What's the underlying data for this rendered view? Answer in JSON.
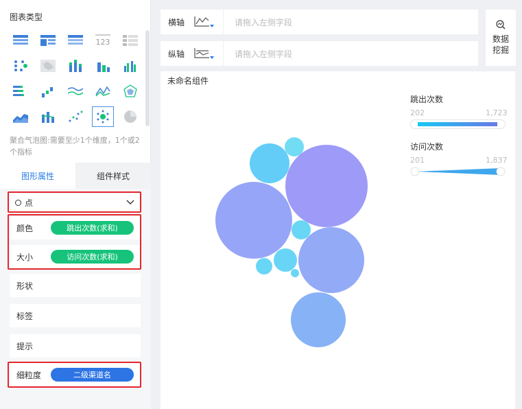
{
  "left_panel": {
    "section_title": "图表类型",
    "chart_types": [
      {
        "icon": "table-icon"
      },
      {
        "icon": "cross-table-icon"
      },
      {
        "icon": "detail-table-icon"
      },
      {
        "icon": "kpi-number-icon",
        "text": "123"
      },
      {
        "icon": "list-icon"
      },
      {
        "icon": "dot-matrix-icon"
      },
      {
        "icon": "map-icon"
      },
      {
        "icon": "stacked-column-icon"
      },
      {
        "icon": "column-icon"
      },
      {
        "icon": "grouped-column-icon"
      },
      {
        "icon": "bar-icon"
      },
      {
        "icon": "waterfall-icon"
      },
      {
        "icon": "line-icon"
      },
      {
        "icon": "radar-line-icon"
      },
      {
        "icon": "radar-icon"
      },
      {
        "icon": "area-icon"
      },
      {
        "icon": "combo-icon"
      },
      {
        "icon": "scatter-icon"
      },
      {
        "icon": "bubble-icon"
      },
      {
        "icon": "pie-icon"
      }
    ],
    "hint": "聚合气泡图:需要至少1个维度，1个或2个指标",
    "tabs": [
      "图形属性",
      "组件样式"
    ],
    "mark_type": "点",
    "properties": {
      "color_label": "颜色",
      "color_field": "跳出次数(求和)",
      "size_label": "大小",
      "size_field": "访问次数(求和)",
      "shape_label": "形状",
      "label_label": "标签",
      "tooltip_label": "提示",
      "granularity_label": "细粒度",
      "granularity_field": "二级渠道名"
    }
  },
  "shelves": {
    "x_label": "横轴",
    "x_placeholder": "请拖入左侧字段",
    "y_label": "纵轴",
    "y_placeholder": "请拖入左侧字段"
  },
  "data_mining": {
    "line1": "数据",
    "line2": "挖掘"
  },
  "chart": {
    "title": "未命名组件",
    "legend": {
      "color_title": "跳出次数",
      "color_min": "202",
      "color_max": "1,723",
      "size_title": "访问次数",
      "size_min": "201",
      "size_max": "1,837"
    }
  },
  "colors": {
    "accent": "#2b7de9",
    "green_pill": "#17c37b",
    "blue_pill": "#2d74e4",
    "highlight": "#e5262d"
  }
}
